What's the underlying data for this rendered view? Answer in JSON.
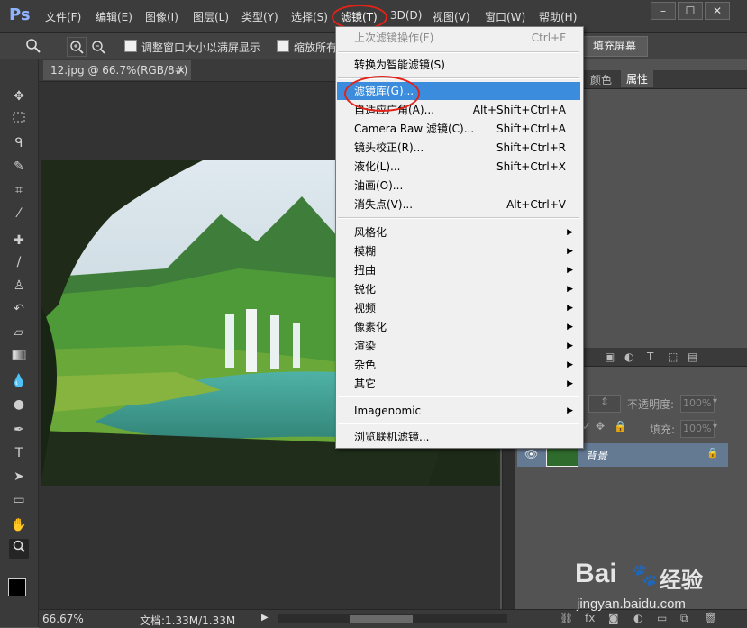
{
  "menubar": {
    "logo": "Ps",
    "items": [
      "文件(F)",
      "编辑(E)",
      "图像(I)",
      "图层(L)",
      "类型(Y)",
      "选择(S)",
      "滤镜(T)",
      "3D(D)",
      "视图(V)",
      "窗口(W)",
      "帮助(H)"
    ],
    "window_controls": [
      "–",
      "☐",
      "✕"
    ]
  },
  "options": {
    "check1": "调整窗口大小以满屏显示",
    "check2": "缩放所有",
    "fill_screen": "填充屏幕"
  },
  "document": {
    "tab": "12.jpg @ 66.7%(RGB/8#)",
    "tab_close": "×",
    "zoom": "66.67%",
    "doc_info": "文档:1.33M/1.33M"
  },
  "panels": {
    "tab_color": "颜色",
    "tab_props": "属性",
    "opacity_label": "不透明度:",
    "opacity_value": "100%",
    "fill_label": "填充:",
    "fill_value": "100%",
    "layer_name": "背景"
  },
  "filter_menu": {
    "last_filter": {
      "label": "上次滤镜操作(F)",
      "shortcut": "Ctrl+F"
    },
    "smart": {
      "label": "转换为智能滤镜(S)"
    },
    "gallery": {
      "label": "滤镜库(G)..."
    },
    "adaptive": {
      "label": "自适应广角(A)...",
      "shortcut": "Alt+Shift+Ctrl+A"
    },
    "camera_raw": {
      "label": "Camera Raw 滤镜(C)...",
      "shortcut": "Shift+Ctrl+A"
    },
    "lens": {
      "label": "镜头校正(R)...",
      "shortcut": "Shift+Ctrl+R"
    },
    "liquify": {
      "label": "液化(L)...",
      "shortcut": "Shift+Ctrl+X"
    },
    "oil": {
      "label": "油画(O)..."
    },
    "vanish": {
      "label": "消失点(V)...",
      "shortcut": "Alt+Ctrl+V"
    },
    "sub": [
      "风格化",
      "模糊",
      "扭曲",
      "锐化",
      "视频",
      "像素化",
      "渲染",
      "杂色",
      "其它"
    ],
    "imagenomic": {
      "label": "Imagenomic"
    },
    "browse": {
      "label": "浏览联机滤镜..."
    }
  },
  "watermark": {
    "brand": "Bai",
    "brand2": "经验",
    "url": "jingyan.baidu.com"
  },
  "colors": {
    "highlight": "#3b8cdc",
    "annotation": "#e2231a",
    "layer_selected": "#647a93"
  }
}
